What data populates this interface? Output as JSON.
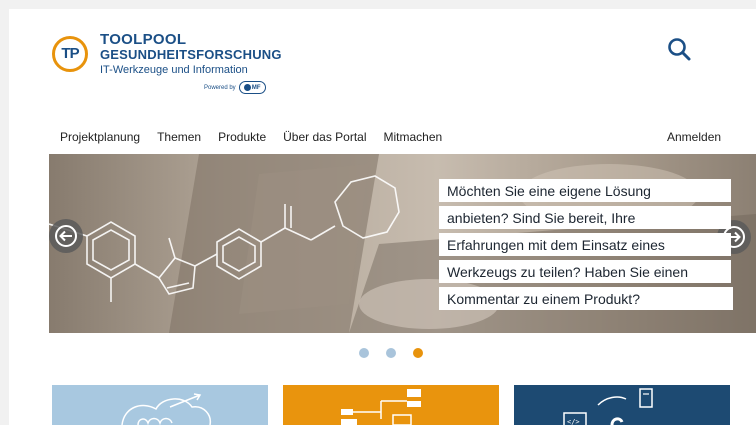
{
  "header": {
    "logo_line1": "TOOLPOOL",
    "logo_line2": "GESUNDHEITSFORSCHUNG",
    "logo_line3": "IT-Werkzeuge und Information",
    "logo_mark": "TP",
    "powered_by": "Powered by",
    "tmf_badge": "MF",
    "search_icon": "search-icon"
  },
  "nav": {
    "items": [
      "Projektplanung",
      "Themen",
      "Produkte",
      "Über das Portal",
      "Mitmachen"
    ],
    "login": "Anmelden"
  },
  "hero": {
    "caption_lines": [
      "Möchten Sie eine eigene Lösung",
      "anbieten? Sind Sie bereit, Ihre",
      "Erfahrungen mit dem Einsatz eines",
      "Werkzeugs zu teilen? Haben Sie einen",
      "Kommentar zu einem Produkt?"
    ],
    "prev_icon": "arrow-left-icon",
    "next_icon": "arrow-right-icon"
  },
  "carousel": {
    "slides": 3,
    "active_index": 2
  },
  "colors": {
    "brand_blue": "#1b4f86",
    "brand_orange": "#e8930c",
    "card_light_blue": "#a8c8e0",
    "card_orange": "#e9940d",
    "card_navy": "#1d4a72"
  },
  "cards": [
    {
      "icon": "chart-growth-icon"
    },
    {
      "icon": "flowchart-icon"
    },
    {
      "icon": "code-book-icon"
    }
  ]
}
